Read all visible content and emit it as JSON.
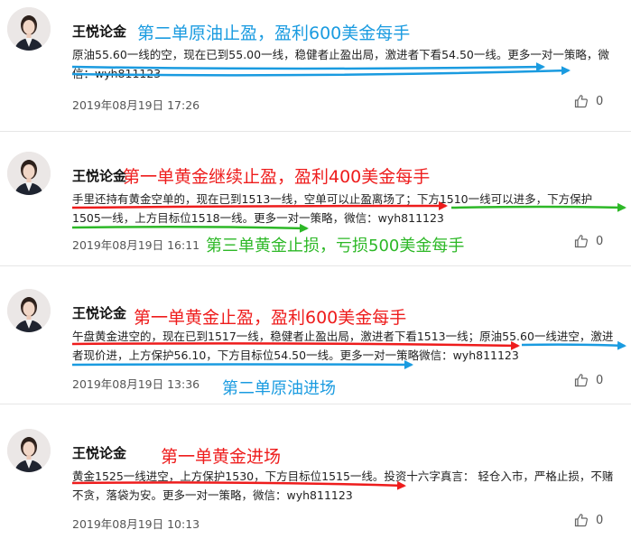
{
  "colors": {
    "blue": "#1a9be0",
    "red": "#ee1c1c",
    "green": "#2db827",
    "text": "#222222"
  },
  "posts": [
    {
      "author": "王悦论金",
      "title": "第二单原油止盈，盈利600美金每手",
      "title_color": "#1a9be0",
      "body": "原油55.60一线的空，现在已到55.00一线，稳健者止盈出局，激进者下看54.50一线。更多一对一策略，微信：wyh811123",
      "time": "2019年08月19日 17:26",
      "likes": "0"
    },
    {
      "author": "王悦论金",
      "title": "第一单黄金继续止盈，盈利400美金每手",
      "title_color": "#ee1c1c",
      "body": "手里还持有黄金空单的，现在已到1513一线，空单可以止盈离场了；下方1510一线可以进多，下方保护1505一线，上方目标位1518一线。更多一对一策略，微信：wyh811123",
      "time": "2019年08月19日 16:11",
      "likes": "0",
      "annotation": "第三单黄金止损，亏损500美金每手",
      "annotation_color": "#2db827"
    },
    {
      "author": "王悦论金",
      "title": "第一单黄金止盈，盈利600美金每手",
      "title_color": "#ee1c1c",
      "body": "午盘黄金进空的，现在已到1517一线，稳健者止盈出局，激进者下看1513一线；原油55.60一线进空，激进者现价进，上方保护56.10，下方目标位54.50一线。更多一对一策略微信：wyh811123",
      "time": "2019年08月19日 13:36",
      "likes": "0",
      "annotation": "第二单原油进场",
      "annotation_color": "#1a9be0"
    },
    {
      "author": "王悦论金",
      "title": "第一单黄金进场",
      "title_color": "#ee1c1c",
      "body": "黄金1525一线进空，上方保护1530，下方目标位1515一线。投资十六字真言：  轻仓入市，严格止损，不赌不贪，落袋为安。更多一对一策略，微信：wyh811123",
      "time": "2019年08月19日 10:13",
      "likes": "0"
    }
  ]
}
